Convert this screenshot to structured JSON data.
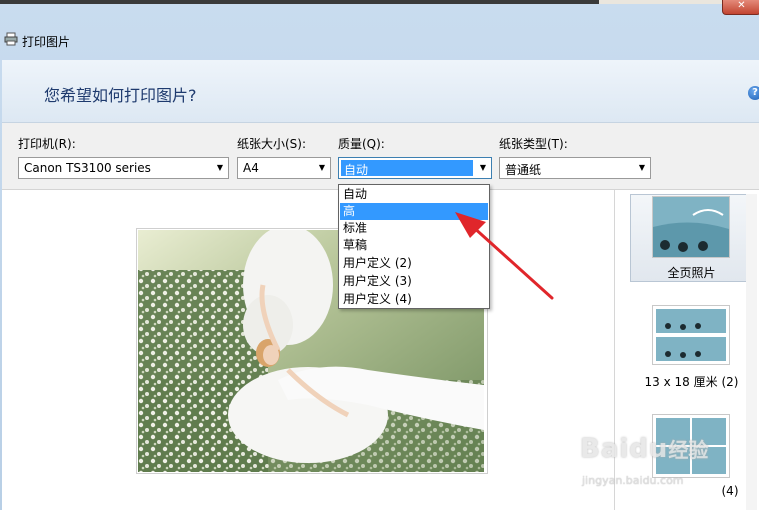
{
  "window": {
    "title": "打印图片",
    "close_label": "✕"
  },
  "header": {
    "question": "您希望如何打印图片?"
  },
  "settings": {
    "printer": {
      "label": "打印机(R):",
      "value": "Canon TS3100 series"
    },
    "paper_size": {
      "label": "纸张大小(S):",
      "value": "A4"
    },
    "quality": {
      "label": "质量(Q):",
      "value": "自动"
    },
    "paper_type": {
      "label": "纸张类型(T):",
      "value": "普通纸"
    },
    "help_icon": "?"
  },
  "quality_dropdown": {
    "items": [
      "自动",
      "高",
      "标准",
      "草稿",
      "用户定义 (2)",
      "用户定义 (3)",
      "用户定义 (4)"
    ],
    "selected_index": 1
  },
  "layouts": {
    "items": [
      {
        "caption": "全页照片",
        "selected": true
      },
      {
        "caption": "13 x 18 厘米 (2)",
        "selected": false
      },
      {
        "caption": "(4)",
        "selected": false
      }
    ]
  },
  "watermark": {
    "brand": "Baidu",
    "suffix": "经验",
    "url": "jingyan.baidu.com"
  },
  "colors": {
    "selection": "#3399ff",
    "annotation_arrow": "#e0262b",
    "header_text": "#1e3a6e"
  }
}
